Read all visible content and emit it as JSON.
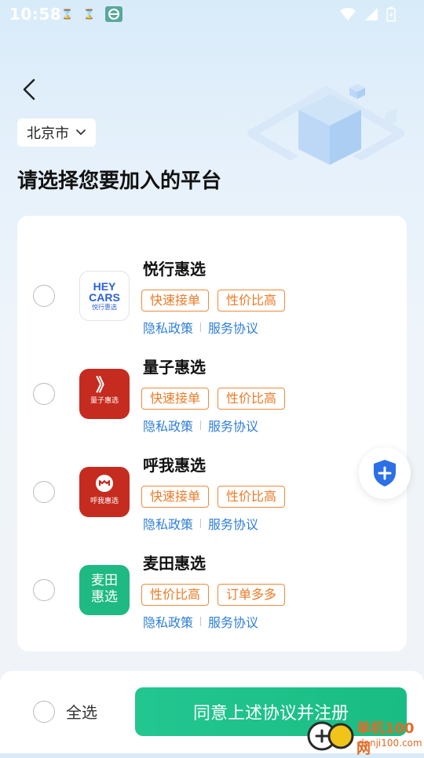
{
  "status": {
    "time": "10:58"
  },
  "header": {
    "city": "北京市",
    "title": "请选择您要加入的平台"
  },
  "platforms": [
    {
      "name": "悦行惠选",
      "logo": {
        "line1": "HEY",
        "line2": "CARS",
        "sub": "悦行惠选"
      },
      "tags": [
        "快速接单",
        "性价比高"
      ],
      "links": {
        "privacy": "隐私政策",
        "service": "服务协议"
      }
    },
    {
      "name": "量子惠选",
      "logo": {
        "mark": "》",
        "sub": "量子惠选"
      },
      "tags": [
        "快速接单",
        "性价比高"
      ],
      "links": {
        "privacy": "隐私政策",
        "service": "服务协议"
      }
    },
    {
      "name": "呼我惠选",
      "logo": {
        "sub": "呼我惠选"
      },
      "tags": [
        "快速接单",
        "性价比高"
      ],
      "links": {
        "privacy": "隐私政策",
        "service": "服务协议"
      }
    },
    {
      "name": "麦田惠选",
      "logo": {
        "line1": "麦田",
        "line2": "惠选"
      },
      "tags": [
        "性价比高",
        "订单多多"
      ],
      "links": {
        "privacy": "隐私政策",
        "service": "服务协议"
      }
    }
  ],
  "footer": {
    "select_all": "全选",
    "agree_button": "同意上述协议并注册"
  },
  "watermark": {
    "brand": "单机100网",
    "url": "danji100.com"
  },
  "colors": {
    "accent_green": "#1fc48a",
    "tag_orange": "#ec7a25",
    "link_blue": "#2f7fd8",
    "logo_red": "#c62b1f",
    "logo_green": "#1fb983"
  }
}
